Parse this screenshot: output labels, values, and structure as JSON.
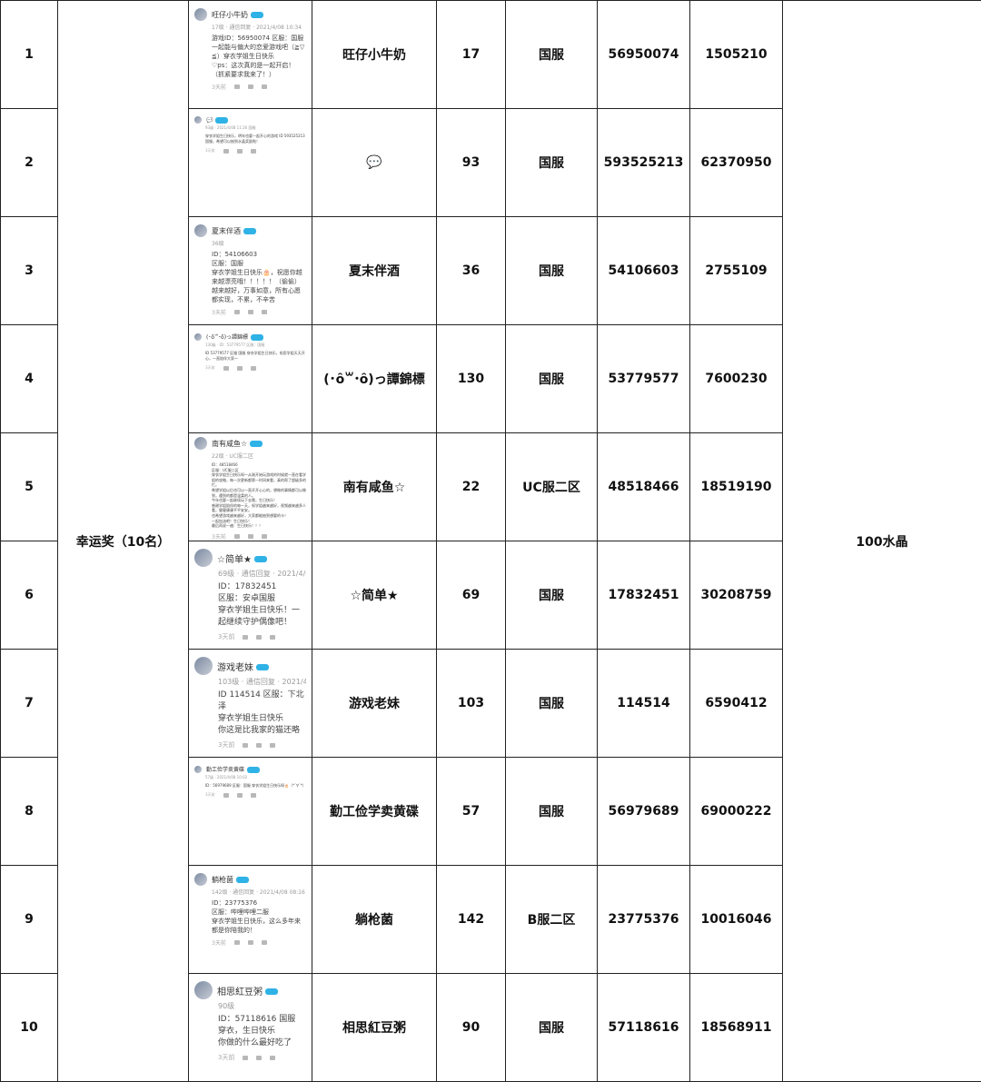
{
  "award": "幸运奖（10名）",
  "prize": "100水晶",
  "rows": [
    {
      "index": "1",
      "nickname": "旺仔小牛奶",
      "level": "17",
      "server": "国服",
      "id": "56950074",
      "uid": "1505210",
      "comment": {
        "user": "旺仔小牛奶",
        "meta": "17级 · 通信回复 · 2021/4/08 10:34",
        "text": "游戏ID：56950074 区服：国服\n一起能与偏大的恋爱游戏吧（≧▽≦）穿衣学姐生日快乐\n♡ps：这次真的是一起开启！（抓紧要求我来了！）",
        "time": "3天前"
      }
    },
    {
      "index": "2",
      "nickname": "💬",
      "level": "93",
      "server": "国服",
      "id": "593525213",
      "uid": "62370950",
      "comment": {
        "user": "💬",
        "meta": "93级 · 2021/4/08 11:26 国服",
        "text": "穿衣学姐生日快乐，明年也要一起开心的游戏 ID 593525213 国服，希望可以抽到水晶奖励啦！",
        "time": "3天前"
      }
    },
    {
      "index": "3",
      "nickname": "夏末伴酒",
      "level": "36",
      "server": "国服",
      "id": "54106603",
      "uid": "2755109",
      "comment": {
        "user": "夏末伴酒",
        "meta": "36级",
        "text": "ID：54106603\n区服：国服\n穿衣学姐生日快乐🎂，祝愿你越来越漂亮哦！！！！！（偷偷）\n越来越好，万事如意，所有心愿都实现，不累，不辛苦",
        "time": "3天前"
      }
    },
    {
      "index": "4",
      "nickname": "(･ȏ꒳･ȏ)っ譚錦標",
      "level": "130",
      "server": "国服",
      "id": "53779577",
      "uid": "7600230",
      "comment": {
        "user": "(･ȏ꒳･ȏ)っ譚錦標",
        "meta": "130级 · ID：53779577 区服：国服",
        "text": "ID 53779577 区服 国服 穿衣学姐生日快乐，祝愿学姐天天开心，一直陪伴大家～",
        "time": "3天前"
      }
    },
    {
      "index": "5",
      "nickname": "南有咸鱼☆",
      "level": "22",
      "server": "UC服二区",
      "id": "48518466",
      "uid": "18519190",
      "comment": {
        "user": "南有咸鱼☆",
        "meta": "22级 · UC服二区",
        "text": "ID：48518466\n区服：UC服二区\n穿衣学姐生日快乐呀～从刚开始玩游戏的时候就一直在看学姐的攻略，每一次更新都第一时间来看，真的帮了超级多的忙。\n希望学姐以后也可以一直开开心心的，想做的事情都可以做到，遇到的都是温柔的人。\n今年也要一起继续玩下去哦，生日快乐！\n感谢学姐陪伴的每一天，祝学姐越来越好，视频越来越多人看，健健康康平平安安。\n也希望游戏越来越好，大家都能抽到想要的卡！\n一起加油吧！生日快乐！\n最后再说一遍：生日快乐！！！",
        "time": "3天前"
      }
    },
    {
      "index": "6",
      "nickname": "☆简单★",
      "level": "69",
      "server": "国服",
      "id": "17832451",
      "uid": "30208759",
      "comment": {
        "user": "☆简单★",
        "meta": "69级 · 通信回复 · 2021/4/08 12:09",
        "text": "ID：17832451\n区服：安卓国服\n穿衣学姐生日快乐！一起继续守护偶像吧！",
        "time": "3天前"
      }
    },
    {
      "index": "7",
      "nickname": "游戏老妹",
      "level": "103",
      "server": "国服",
      "id": "114514",
      "uid": "6590412",
      "comment": {
        "user": "游戏老妹",
        "meta": "103级 · 通信回复 · 2021/4/08 09:30",
        "text": "ID 114514 区服：下北泽\n穿衣学姐生日快乐\n你这是比我家的猫还略",
        "time": "3天前"
      }
    },
    {
      "index": "8",
      "nickname": "勤工俭学卖黄碟",
      "level": "57",
      "server": "国服",
      "id": "56979689",
      "uid": "69000222",
      "comment": {
        "user": "勤工俭学卖黄碟",
        "meta": "57级 · 2021/4/08 10:02",
        "text": "ID：56979689 区服：国服 穿衣学姐生日快乐呀🎂（*´∀`*）",
        "time": "3天前"
      }
    },
    {
      "index": "9",
      "nickname": "躺枪菌",
      "level": "142",
      "server": "B服二区",
      "id": "23775376",
      "uid": "10016046",
      "comment": {
        "user": "躺枪菌",
        "meta": "142级 · 通信回复 · 2021/4/08 08:16",
        "text": "ID：23775376\n区服：哔哩哔哩二服\n穿衣学姐生日快乐，这么多年来都是你陪我的！",
        "time": "3天前"
      }
    },
    {
      "index": "10",
      "nickname": "相思紅豆粥",
      "level": "90",
      "server": "国服",
      "id": "57118616",
      "uid": "18568911",
      "comment": {
        "user": "相思紅豆粥",
        "meta": "90级",
        "text": "ID：57118616  国服\n穿衣，生日快乐\n你做的什么最好吃了",
        "time": "3天前"
      }
    }
  ]
}
